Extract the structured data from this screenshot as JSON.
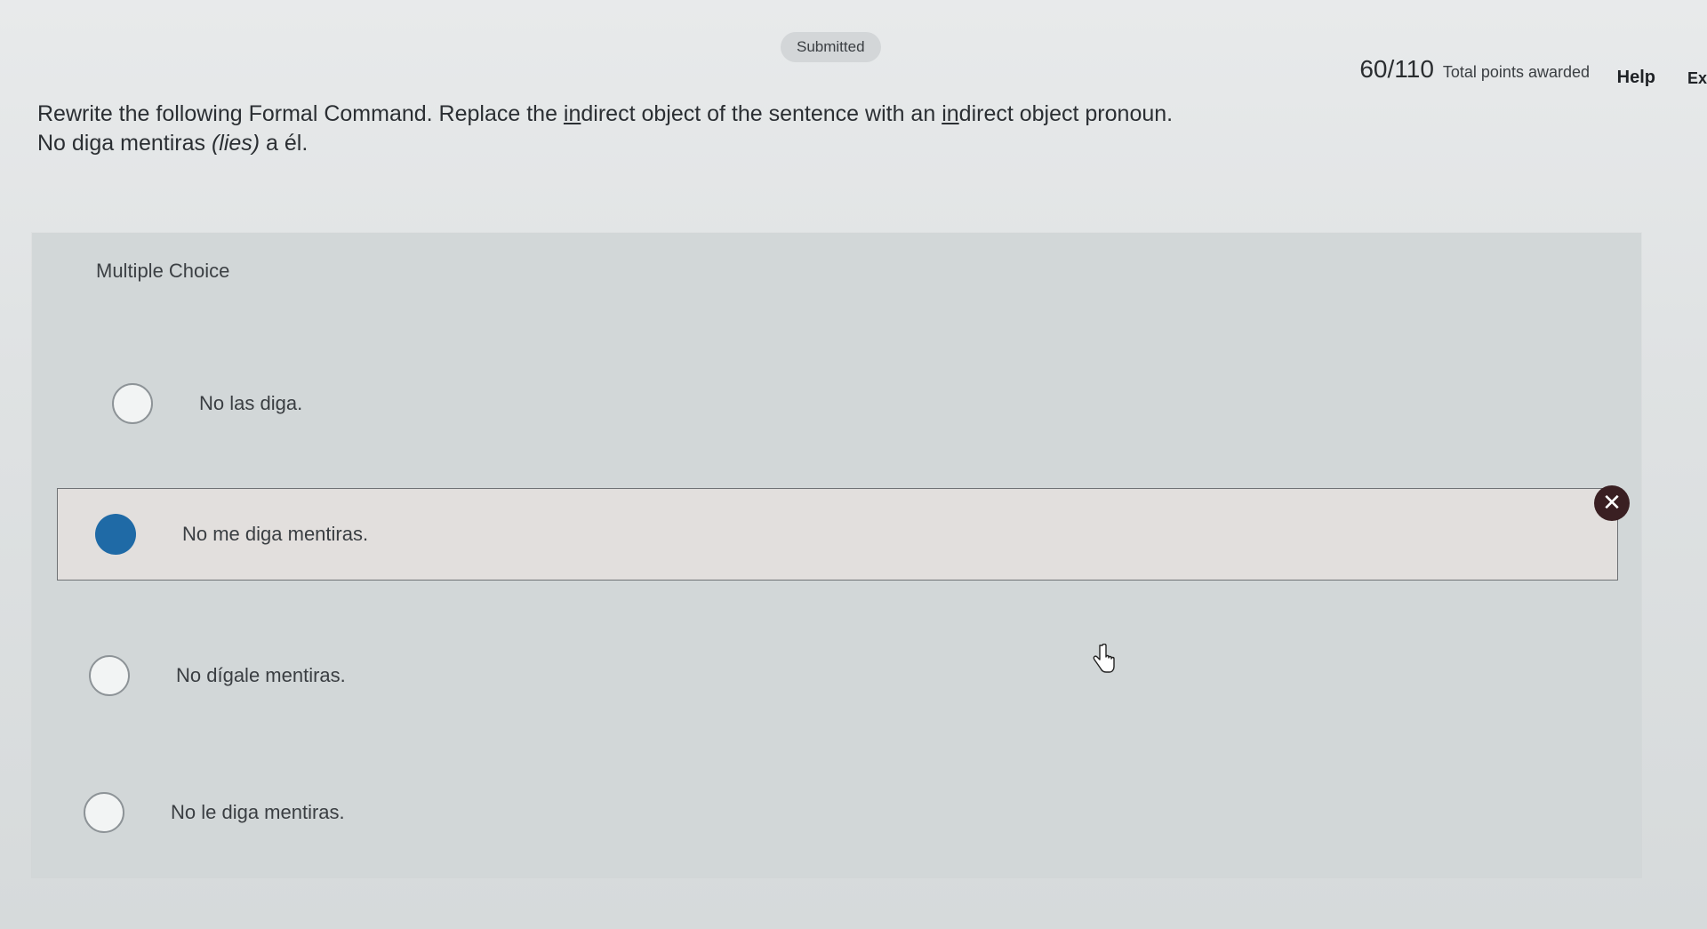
{
  "header": {
    "status": "Submitted",
    "score_value": "60/110",
    "score_label": "Total points awarded",
    "help": "Help",
    "exit": "Exit"
  },
  "question": {
    "prompt_part1": "Rewrite the following Formal Command. Replace the ",
    "prompt_u1": "in",
    "prompt_part2": "direct object of the sentence with an ",
    "prompt_u2": "in",
    "prompt_part3": "direct object pronoun.",
    "sentence_part1": "No diga mentiras ",
    "sentence_italic": "(lies)",
    "sentence_part2": " a él."
  },
  "multiple_choice": {
    "title": "Multiple Choice",
    "options": [
      {
        "label": "No las diga.",
        "selected": false
      },
      {
        "label": "No me diga mentiras.",
        "selected": true,
        "result": "incorrect"
      },
      {
        "label": "No dígale mentiras.",
        "selected": false
      },
      {
        "label": "No le diga mentiras.",
        "selected": false
      }
    ]
  },
  "colors": {
    "selected_radio": "#1f6aa6",
    "incorrect_badge": "#3a1f22"
  },
  "icons": {
    "incorrect": "x-circle-icon",
    "cursor": "hand-pointer-icon"
  }
}
